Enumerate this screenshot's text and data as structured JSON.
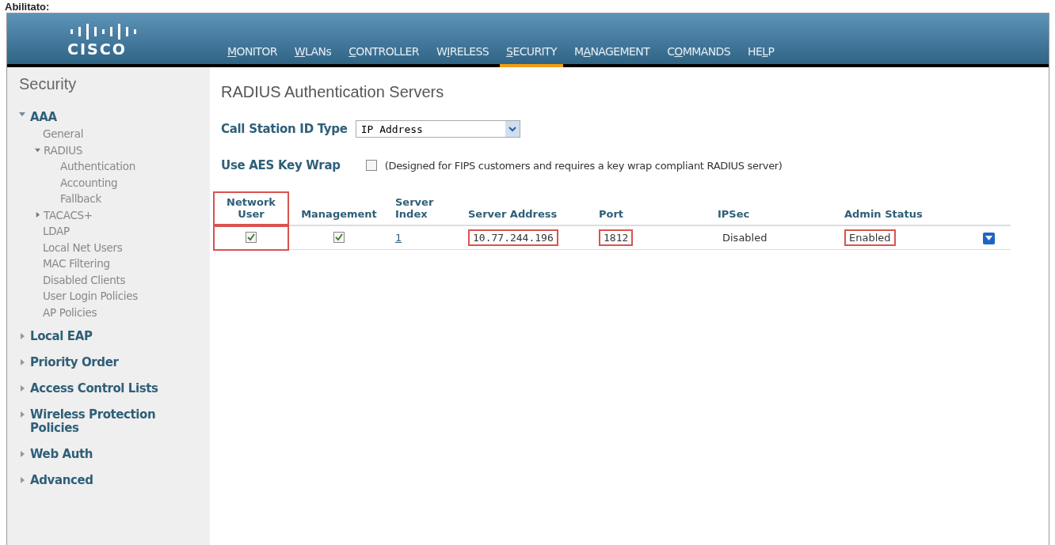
{
  "caption": "Abilitato:",
  "header": {
    "logo": "CISCO",
    "nav": [
      {
        "key": "M",
        "suffix": "ONITOR",
        "selected": false
      },
      {
        "key": "W",
        "suffix": "LANs",
        "selected": false
      },
      {
        "key": "C",
        "suffix": "ONTROLLER",
        "selected": false
      },
      {
        "prefix": "W",
        "key": "I",
        "suffix": "RELESS",
        "selected": false
      },
      {
        "key": "S",
        "suffix": "ECURITY",
        "selected": true
      },
      {
        "prefix": "M",
        "key": "A",
        "suffix": "NAGEMENT",
        "selected": false
      },
      {
        "prefix": "C",
        "key": "O",
        "suffix": "MMANDS",
        "selected": false
      },
      {
        "prefix": "HE",
        "key": "L",
        "suffix": "P",
        "selected": false
      }
    ]
  },
  "sidebar": {
    "title": "Security",
    "sections": [
      {
        "label": "AAA",
        "expanded": true,
        "children": [
          {
            "label": "General"
          },
          {
            "label": "RADIUS",
            "expanded": true,
            "children": [
              {
                "label": "Authentication"
              },
              {
                "label": "Accounting"
              },
              {
                "label": "Fallback"
              }
            ]
          },
          {
            "label": "TACACS+",
            "expanded": false
          },
          {
            "label": "LDAP"
          },
          {
            "label": "Local Net Users"
          },
          {
            "label": "MAC Filtering"
          },
          {
            "label": "Disabled Clients"
          },
          {
            "label": "User Login Policies"
          },
          {
            "label": "AP Policies"
          }
        ]
      },
      {
        "label": "Local EAP",
        "expanded": false
      },
      {
        "label": "Priority Order",
        "expanded": false
      },
      {
        "label": "Access Control Lists",
        "expanded": false
      },
      {
        "label": "Wireless Protection Policies",
        "expanded": false
      },
      {
        "label": "Web Auth",
        "expanded": false
      },
      {
        "label": "Advanced",
        "expanded": false
      }
    ]
  },
  "page_title": "RADIUS Authentication Servers",
  "call_station": {
    "label": "Call Station ID Type",
    "value": "IP Address"
  },
  "aes_key_wrap": {
    "label": "Use AES Key Wrap",
    "checked": false,
    "note": "(Designed for FIPS customers and requires a key wrap compliant RADIUS server)"
  },
  "table": {
    "columns": [
      {
        "label": "Network User",
        "highlighted": true
      },
      {
        "label": "Management",
        "highlighted": false
      },
      {
        "label": "Server Index",
        "highlighted": false
      },
      {
        "label": "Server Address",
        "highlighted": false
      },
      {
        "label": "Port",
        "highlighted": false
      },
      {
        "label": "IPSec",
        "highlighted": false
      },
      {
        "label": "Admin Status",
        "highlighted": false
      }
    ],
    "rows": [
      {
        "network_user": {
          "checked": true
        },
        "management": {
          "checked": true
        },
        "server_index": "1",
        "server_address": {
          "text": "10.77.244.196",
          "highlighted": true
        },
        "port": {
          "text": "1812",
          "highlighted": true
        },
        "ipsec": {
          "text": "Disabled",
          "highlighted": false
        },
        "admin_status": {
          "text": "Enabled",
          "highlighted": true
        }
      }
    ]
  }
}
